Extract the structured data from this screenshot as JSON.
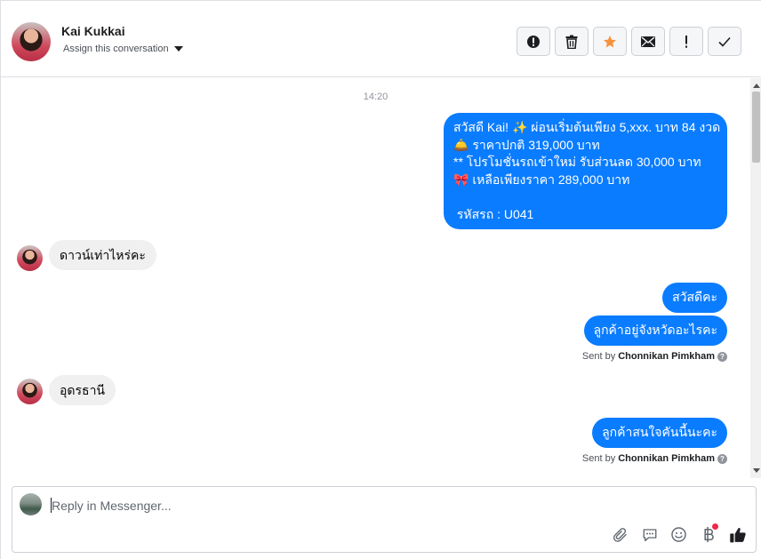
{
  "header": {
    "contact_name": "Kai Kukkai",
    "assign_label": "Assign this conversation",
    "actions": [
      {
        "name": "mark-spam-button",
        "icon": "alert-circle-icon"
      },
      {
        "name": "delete-button",
        "icon": "trash-icon"
      },
      {
        "name": "star-button",
        "icon": "star-icon"
      },
      {
        "name": "mark-unread-button",
        "icon": "envelope-icon"
      },
      {
        "name": "follow-up-button",
        "icon": "exclamation-icon"
      },
      {
        "name": "mark-done-button",
        "icon": "checkmark-icon"
      }
    ],
    "star_color": "#f7923b"
  },
  "conversation": {
    "timestamp": "14:20",
    "promo_lines": [
      "สวัสดี Kai! ✨  ผ่อนเริ่มต้นเพียง 5,xxx. บาท 84 งวด",
      "🛎️ ราคาปกติ 319,000 บาท",
      "** โปรโมชั่นรถเข้าใหม่ รับส่วนลด 30,000 บาท",
      "🎀  เหลือเพียงราคา 289,000 บาท",
      "",
      " รหัสรถ : U041"
    ],
    "incoming_1": "ดาวน์เท่าไหร่คะ",
    "outgoing_1": "สวัสดีคะ",
    "outgoing_2": "ลูกค้าอยู่จังหวัดอะไรคะ",
    "sent_by_prefix": "Sent by",
    "sent_by_name": "Chonnikan Pimkham",
    "incoming_2": "อุดรธานี",
    "outgoing_3": "ลูกค้าสนใจคันนี้นะคะ",
    "help_mark": "?"
  },
  "composer": {
    "placeholder": "Reply in Messenger...",
    "tools": [
      "paperclip-icon",
      "saved-reply-icon",
      "emoji-icon",
      "baht-payment-icon",
      "like-icon"
    ]
  },
  "colors": {
    "outgoing_bubble": "#0a7cff",
    "incoming_bubble": "#f0f0f0",
    "notification_dot": "#f02849"
  }
}
